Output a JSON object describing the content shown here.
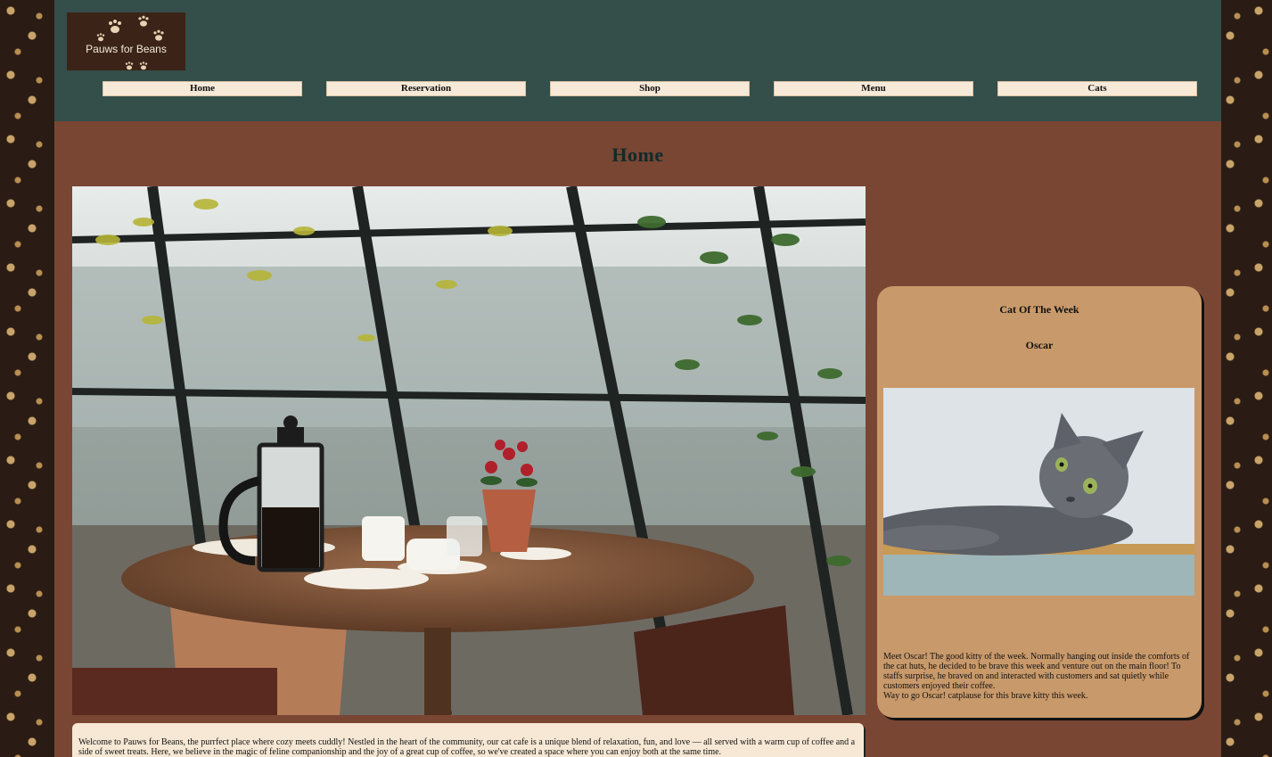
{
  "header": {
    "logo_text": "Pauws for Beans",
    "nav": [
      {
        "label": "Home"
      },
      {
        "label": "Reservation"
      },
      {
        "label": "Shop"
      },
      {
        "label": "Menu"
      },
      {
        "label": "Cats"
      }
    ]
  },
  "main": {
    "title": "Home",
    "welcome_text": "Welcome to Pauws for Beans, the purrfect place where cozy meets cuddly! Nestled in the heart of the community, our cat cafe is a unique blend of relaxation, fun, and love — all served with a warm cup of coffee and a side of sweet treats. Here, we believe in the magic of feline companionship and the joy of a great cup of coffee, so we've created a space where you can enjoy both at the same time."
  },
  "cat_of_week": {
    "heading": "Cat Of The Week",
    "name": "Oscar",
    "description": "Meet Oscar! The good kitty of the week. Normally hanging out inside the comforts of the cat huts, he decided to be brave this week and venture out on the main floor! To staffs surprise, he braved on and interacted with customers and sat quietly while customers enjoyed their coffee.",
    "cheer": "Way to go Oscar! catplause for this brave kitty this week."
  },
  "colors": {
    "header_bg": "#344e4a",
    "page_bg": "#7a4634",
    "nav_button_bg": "#f7e9d8",
    "card_bg": "#c8996a"
  }
}
